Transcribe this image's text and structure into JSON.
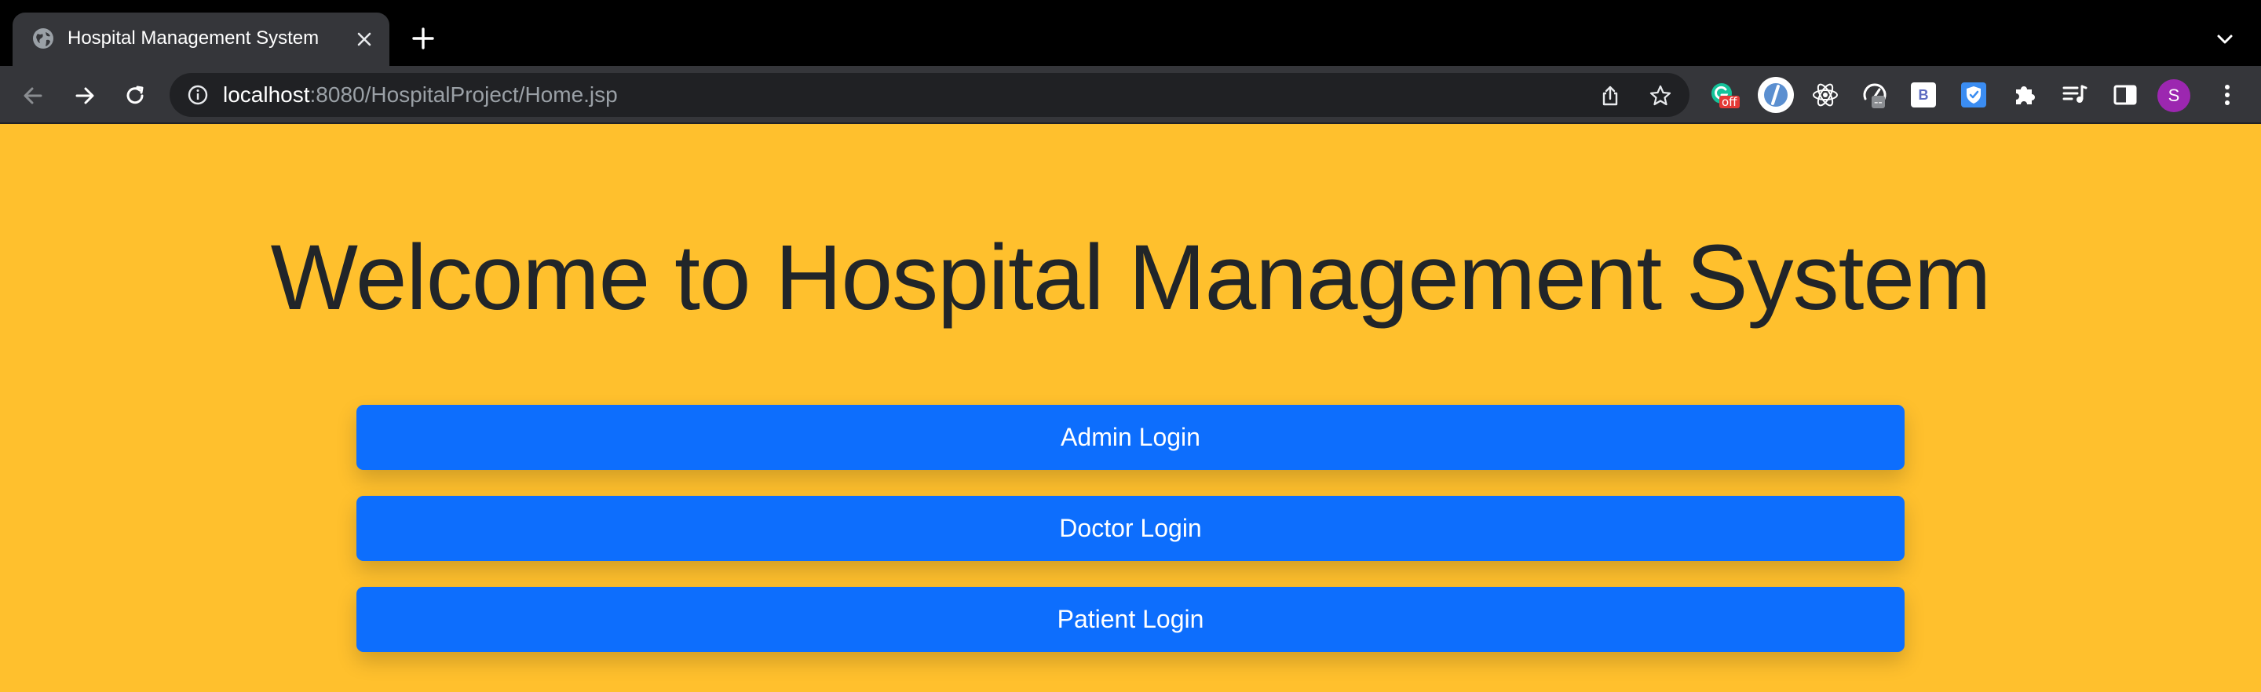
{
  "browser": {
    "tab": {
      "title": "Hospital Management System"
    },
    "address_bar": {
      "host": "localhost",
      "path": ":8080/HospitalProject/Home.jsp"
    },
    "extensions": {
      "grammarly_badge": "off",
      "ext_badge": "--",
      "b_ext_label": "B"
    },
    "profile_initial": "S"
  },
  "page": {
    "heading": "Welcome to Hospital Management System",
    "buttons": {
      "admin": "Admin Login",
      "doctor": "Doctor Login",
      "patient": "Patient Login"
    }
  },
  "colors": {
    "page_background": "#ffc02d",
    "button_primary": "#0d6efd",
    "heading_text": "#212529",
    "chrome_dark": "#35363a"
  }
}
